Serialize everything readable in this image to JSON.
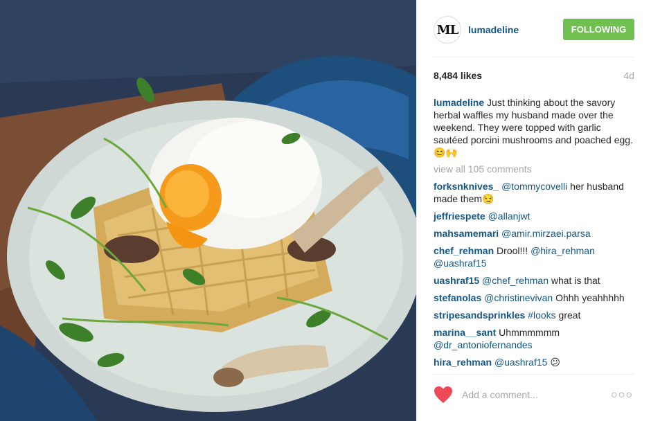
{
  "post": {
    "photo_alt": "Herbal waffles topped with poached egg and mushrooms",
    "avatar_text": "ML",
    "username": "lumadeline",
    "follow_label": "Following",
    "likes": "8,484 likes",
    "time_ago": "4d",
    "caption": {
      "user": "lumadeline",
      "text": "Just thinking about the savory herbal waffles my husband made over the weekend. They were topped with garlic sautéed porcini mushrooms and poached egg. 😊🙌"
    },
    "view_all": "view all 105 comments",
    "comments": [
      {
        "user": "forksnknives_",
        "mention": "@tommycovelli",
        "text": "her husband made them😏"
      },
      {
        "user": "jeffriespete",
        "mention": "@allanjwt",
        "text": ""
      },
      {
        "user": "mahsamemari",
        "mention": "@amir.mirzaei.parsa",
        "text": ""
      },
      {
        "user": "chef_rehman",
        "pre": "Drool!!!",
        "mention": "@hira_rehman",
        "mention2": "@uashraf15",
        "text": ""
      },
      {
        "user": "uashraf15",
        "mention": "@chef_rehman",
        "text": "what is that"
      },
      {
        "user": "stefanolas",
        "mention": "@christinevivan",
        "text": "Ohhh yeahhhhh"
      },
      {
        "user": "stripesandsprinkles",
        "mention": "#looks",
        "text": "great"
      },
      {
        "user": "marina__sant",
        "pre": "Uhmmmmmm",
        "mention": "@dr_antoniofernandes",
        "text": ""
      },
      {
        "user": "hira_rehman",
        "mention": "@uashraf15",
        "text": "😕"
      }
    ],
    "comment_placeholder": "Add a comment...",
    "more_label": "○○○",
    "colors": {
      "link": "#125688",
      "follow": "#70c050",
      "heart": "#ed4956",
      "muted": "#a5a7aa"
    },
    "icons": {
      "like": "heart-icon",
      "options": "more-options-icon"
    }
  }
}
